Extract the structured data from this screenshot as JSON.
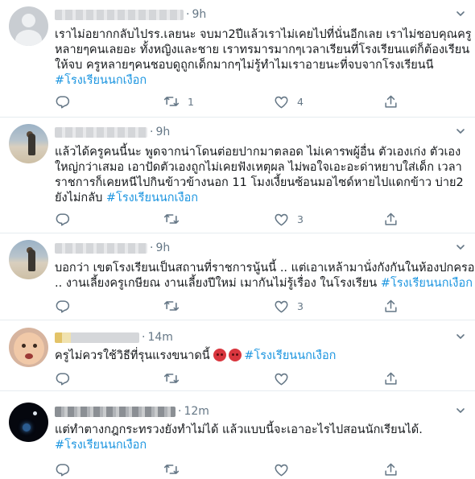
{
  "tweets": [
    {
      "time": "9h",
      "lines": [
        "เราไม่อยากกลับไปรร.เลยนะ จบมา2ปีแล้วเราไม่เคยไปที่นั่นอีกเลย เราไม่ชอบคุณครู",
        "หลายๆคนเลยอะ ทั้งหญิงและชาย เราทรมารมากๆเวลาเรียนที่โรงเรียนแต่ก็ต้องเรียน",
        "ให้จบ ครูหลายๆคนชอบดูถูกเด็กมากๆไม่รู้ทำไมเราอายนะที่จบจากโรงเรียนนี"
      ],
      "hashtag": "#โรงเรียนนกเงือก",
      "retweets": "1",
      "likes": "4"
    },
    {
      "time": "9h",
      "lines": [
        "แล้วได้ครูคนนี้นะ พูดจากน่าโดนต่อยปากมาตลอด ไม่เคารพผู้อื่น ตัวเองเก่ง ตัวเอง",
        "ใหญ่กว่าเสมอ เอาปัดตัวเองถูกไม่เคยฟังเหตุผล ไม่พอใจเอะอะด่าหยาบใส่เด็ก เวลา",
        "ราชการก็เคยหนีไปกินข้าวข้างนอก 11 โมงเงี้ยนซ้อนมอไซด์หายไปแดกข้าว บ่าย2"
      ],
      "last_line_prefix": "ยังไม่กลับ ",
      "hashtag": "#โรงเรียนนกเงือก",
      "retweets": "",
      "likes": "3"
    },
    {
      "time": "9h",
      "lines": [
        "บอกว่า เขตโรงเรียนเป็นสถานที่ราชการนู้นนี้ .. แต่เอาเหล้ามานั่งกังกันในห้องปกครอง"
      ],
      "last_line_prefix": ".. งานเลี้ยงครูเกษียณ งานเลี้ยงปีใหม่ เมากันไม่รู้เรื่อง ในโรงเรียน ",
      "hashtag": "#โรงเรียนนกเงือก",
      "retweets": "",
      "likes": "3"
    },
    {
      "time": "14m",
      "lines": [],
      "last_line_prefix": "ครูไม่ควรใช้วิธีที่รุนแรงขนาดนี้ ",
      "hashtag": "#โรงเรียนนกเงือก",
      "retweets": "",
      "likes": ""
    },
    {
      "time": "12m",
      "lines": [
        "แต่ทำตางกฎกระทรวงยังทำไม่ได้ แล้วแบบนี้จะเอาอะไรไปสอนนักเรียนได้."
      ],
      "hashtag": "#โรงเรียนนกเงือก",
      "retweets": "",
      "likes": ""
    }
  ],
  "colors": {
    "hashtag": "#1b95e0",
    "icon": "#657786",
    "divider": "#e6ecf0"
  },
  "icons": [
    "caret-down-icon",
    "reply-icon",
    "retweet-icon",
    "like-icon",
    "share-icon",
    "angry-emoji-icon"
  ]
}
